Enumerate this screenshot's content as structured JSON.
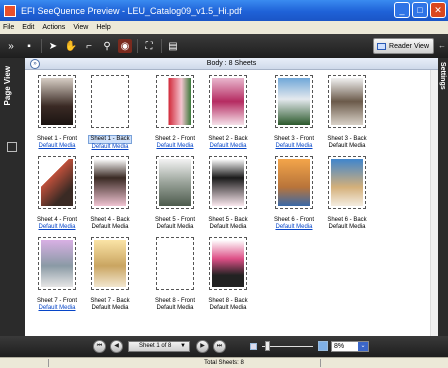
{
  "window": {
    "title": "EFI SeeQuence Preview - LEU_Catalog09_v1.5_Hi.pdf"
  },
  "menu": [
    "File",
    "Edit",
    "Actions",
    "View",
    "Help"
  ],
  "toolbar": {
    "reader_view_label": "Reader View"
  },
  "side_panels": {
    "left_label": "Page View",
    "right_label": "Settings"
  },
  "content": {
    "header": "Body : 8 Sheets"
  },
  "sheets": [
    {
      "label": "Sheet 1 - Front",
      "media": "Default Media",
      "media_link": true
    },
    {
      "label": "Sheet 1 - Back",
      "media": "Default Media",
      "media_link": true,
      "selected": true
    },
    {
      "label": "Sheet 2 - Front",
      "media": "Default Media",
      "media_link": true
    },
    {
      "label": "Sheet 2 - Back",
      "media": "Default Media",
      "media_link": true
    },
    {
      "label": "Sheet 3 - Front",
      "media": "Default Media",
      "media_link": true
    },
    {
      "label": "Sheet 3 - Back",
      "media": "Default Media",
      "media_link": false
    },
    {
      "label": "Sheet 4 - Front",
      "media": "Default Media",
      "media_link": true
    },
    {
      "label": "Sheet 4 - Back",
      "media": "Default Media",
      "media_link": false
    },
    {
      "label": "Sheet 5 - Front",
      "media": "Default Media",
      "media_link": false
    },
    {
      "label": "Sheet 5 - Back",
      "media": "Default Media",
      "media_link": false
    },
    {
      "label": "Sheet 6 - Front",
      "media": "Default Media",
      "media_link": true
    },
    {
      "label": "Sheet 6 - Back",
      "media": "Default Media",
      "media_link": false
    },
    {
      "label": "Sheet 7 - Front",
      "media": "Default Media",
      "media_link": true
    },
    {
      "label": "Sheet 7 - Back",
      "media": "Default Media",
      "media_link": false
    },
    {
      "label": "Sheet 8 - Front",
      "media": "Default Media",
      "media_link": false
    },
    {
      "label": "Sheet 8 - Back",
      "media": "Default Media",
      "media_link": false
    }
  ],
  "nav": {
    "sheet_selector": "Sheet 1 of 8",
    "zoom": "8%",
    "zoom_slider_level": 0.05
  },
  "status": {
    "text": "Total Sheets: 8"
  },
  "colors": {
    "titlebar": "#1f62d8",
    "toolbar": "#2a2a2a",
    "link": "#0645c8",
    "selection": "#cfe1fb"
  }
}
